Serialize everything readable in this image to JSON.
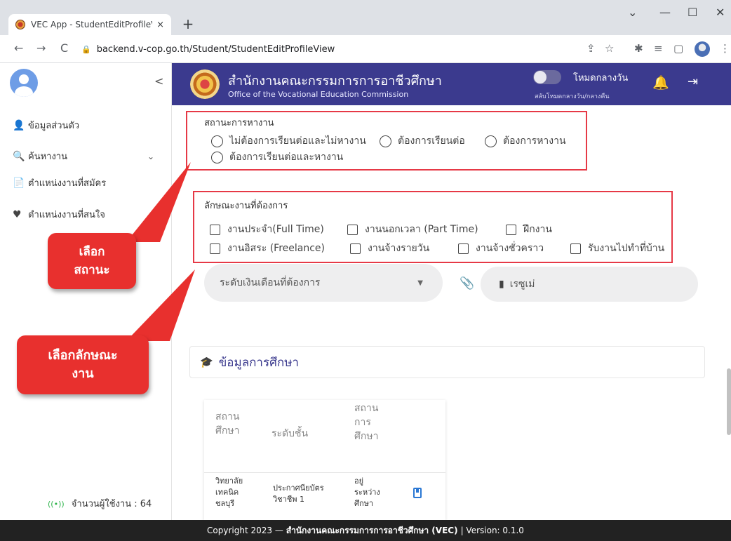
{
  "browser": {
    "tab_title": "VEC App - StudentEditProfileVie",
    "tab_close": "×",
    "new_tab": "+",
    "url": "backend.v-cop.go.th/Student/StudentEditProfileView",
    "min": "—",
    "max": "☐",
    "close": "✕",
    "dropdown": "⌄",
    "back": "←",
    "forward": "→",
    "reload": "C"
  },
  "sidebar": {
    "collapse": "<",
    "items": [
      {
        "label": "ข้อมูลส่วนตัว",
        "icon": "person-icon"
      },
      {
        "label": "ค้นหางาน",
        "icon": "search-doc-icon"
      },
      {
        "label": "ตำแหน่งงานที่สมัคร",
        "icon": "doc-check-icon"
      },
      {
        "label": "ตำแหน่งงานที่สนใจ",
        "icon": "heart-icon"
      }
    ],
    "online_label": "จำนวนผู้ใช้งาน : 64"
  },
  "header": {
    "org_th": "สำนักงานคณะกรรมการการอาชีวศึกษา",
    "org_en": "Office of the Vocational Education Commission",
    "mode_label": "โหมดกลางวัน",
    "mode_sub": "สลับโหมดกลางวัน/กลางคืน"
  },
  "job_status": {
    "title": "สถานะการหางาน",
    "options": [
      "ไม่ต้องการเรียนต่อและไม่หางาน",
      "ต้องการเรียนต่อ",
      "ต้องการหางาน",
      "ต้องการเรียนต่อและหางาน"
    ]
  },
  "job_type": {
    "title": "ลักษณะงานที่ต้องการ",
    "options": [
      "งานประจำ(Full Time)",
      "งานนอกเวลา (Part Time)",
      "ฝึกงาน",
      "งานอิสระ (Freelance)",
      "งานจ้างรายวัน",
      "งานจ้างชั่วคราว",
      "รับงานไปทำที่บ้าน"
    ]
  },
  "salary_placeholder": "ระดับเงินเดือนที่ต้องการ",
  "resume_label": "เรซูเม่",
  "education": {
    "title": "ข้อมูลการศึกษา",
    "headers": [
      "สถาน\nศึกษา",
      "ระดับชั้น",
      "สถาน\nการ\nศึกษา"
    ],
    "row": [
      "วิทยาลัย\nเทคนิค\nชลบุรี",
      "ประกาศนียบัตร\nวิชาชีพ 1",
      "อยู่\nระหว่าง\nศึกษา"
    ]
  },
  "footer": {
    "prefix": "Copyright 2023 —",
    "org": "สำนักงานคณะกรรมการการอาชีวศึกษา (VEC)",
    "suffix": "| Version: 0.1.0"
  },
  "callouts": {
    "status": "เลือก\nสถานะ",
    "type": "เลือกลักษณะ\nงาน"
  },
  "colors": {
    "header": "#3b3a8e",
    "callout": "#e8302e",
    "highlight": "#e63946",
    "footer": "#222222"
  }
}
